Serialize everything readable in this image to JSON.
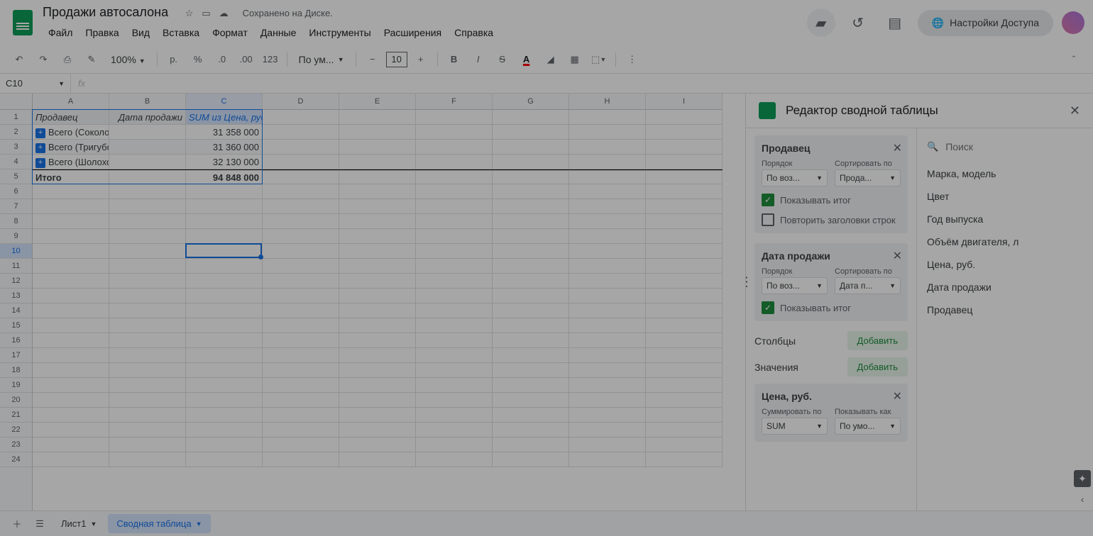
{
  "doc": {
    "title": "Продажи автосалона",
    "saveStatus": "Сохранено на Диске."
  },
  "menu": {
    "file": "Файл",
    "edit": "Правка",
    "view": "Вид",
    "insert": "Вставка",
    "format": "Формат",
    "data": "Данные",
    "tools": "Инструменты",
    "extensions": "Расширения",
    "help": "Справка"
  },
  "share": "Настройки Доступа",
  "toolbar": {
    "zoom": "100%",
    "currency": "р.",
    "percent": "%",
    "numfmt": "123",
    "font": "По ум...",
    "fontSize": "10"
  },
  "nameBox": "C10",
  "cols": [
    "A",
    "B",
    "C",
    "D",
    "E",
    "F",
    "G",
    "H",
    "I"
  ],
  "pivot": {
    "hdr": {
      "a": "Продавец",
      "b": "Дата продажи",
      "c": "SUM из Цена, руб."
    },
    "rows": [
      {
        "label": "Всего (Соколов П.)",
        "val": "31 358 000"
      },
      {
        "label": "Всего (Тригубов М.)",
        "val": "31 360 000"
      },
      {
        "label": "Всего (Шолохов Г.)",
        "val": "32 130 000"
      }
    ],
    "total": {
      "label": "Итого",
      "val": "94 848 000"
    }
  },
  "panel": {
    "title": "Редактор сводной таблицы",
    "search": "Поиск",
    "rows": {
      "seller": {
        "title": "Продавец",
        "orderLbl": "Порядок",
        "orderVal": "По воз...",
        "sortLbl": "Сортировать по",
        "sortVal": "Прода...",
        "showTotal": "Показывать итог",
        "repeat": "Повторить заголовки строк"
      },
      "date": {
        "title": "Дата продажи",
        "orderLbl": "Порядок",
        "orderVal": "По воз...",
        "sortLbl": "Сортировать по",
        "sortVal": "Дата п...",
        "showTotal": "Показывать итог"
      }
    },
    "columns": {
      "label": "Столбцы",
      "add": "Добавить"
    },
    "values": {
      "label": "Значения",
      "add": "Добавить",
      "price": {
        "title": "Цена, руб.",
        "sumLbl": "Суммировать по",
        "sumVal": "SUM",
        "showLbl": "Показывать как",
        "showVal": "По умо..."
      }
    },
    "fields": [
      "Марка, модель",
      "Цвет",
      "Год выпуска",
      "Объём двигателя, л",
      "Цена, руб.",
      "Дата продажи",
      "Продавец"
    ]
  },
  "footer": {
    "tab1": "Лист1",
    "tab2": "Сводная таблица"
  }
}
